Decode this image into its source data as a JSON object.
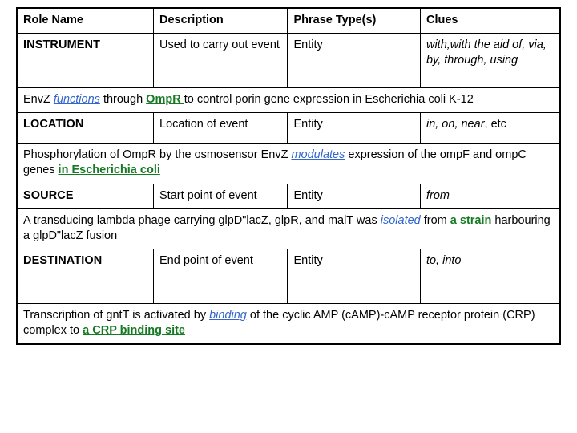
{
  "table": {
    "headers": [
      "Role Name",
      "Description",
      "Phrase Type(s)",
      "Clues"
    ],
    "rows": [
      {
        "role": "INSTRUMENT",
        "description": "Used to carry out event",
        "phrase_type": "Entity",
        "clues_italic": "with,with the aid of, via, by, through, using",
        "clues_plain": ""
      },
      {
        "role": "LOCATION",
        "description": "Location of event",
        "phrase_type": "Entity",
        "clues_italic": "in, on, near",
        "clues_plain": ", etc"
      },
      {
        "role": "SOURCE",
        "description": "Start point of event",
        "phrase_type": "Entity",
        "clues_italic": "from",
        "clues_plain": ""
      },
      {
        "role": "DESTINATION",
        "description": "End point of event",
        "phrase_type": "Entity",
        "clues_italic": "to, into",
        "clues_plain": ""
      }
    ],
    "examples": [
      {
        "seg1": "EnvZ ",
        "trigger": "functions",
        "seg2": " through ",
        "argument": "OmpR ",
        "seg3": "to control porin gene expression in Escherichia coli K-12"
      },
      {
        "seg1": "Phosphorylation of OmpR by the osmosensor EnvZ ",
        "trigger": "modulates",
        "seg2": " expression of the ompF and ompC genes ",
        "argument": "in Escherichia coli",
        "seg3": ""
      },
      {
        "seg1": "A transducing lambda phage carrying glpD\"lacZ, glpR, and malT was ",
        "trigger": "isolated",
        "seg2": " from ",
        "argument": "a strain",
        "seg3": " harbouring a glpD\"lacZ fusion"
      },
      {
        "seg1": "Transcription of gntT is activated by ",
        "trigger": "binding",
        "seg2": " of the cyclic AMP (cAMP)-cAMP receptor protein (CRP) complex to ",
        "argument": "a CRP binding site",
        "seg3": ""
      }
    ]
  },
  "colors": {
    "role_name": "#cc3a17",
    "trigger": "#3366cc",
    "argument": "#157a22",
    "border": "#000000",
    "background": "#ffffff"
  }
}
